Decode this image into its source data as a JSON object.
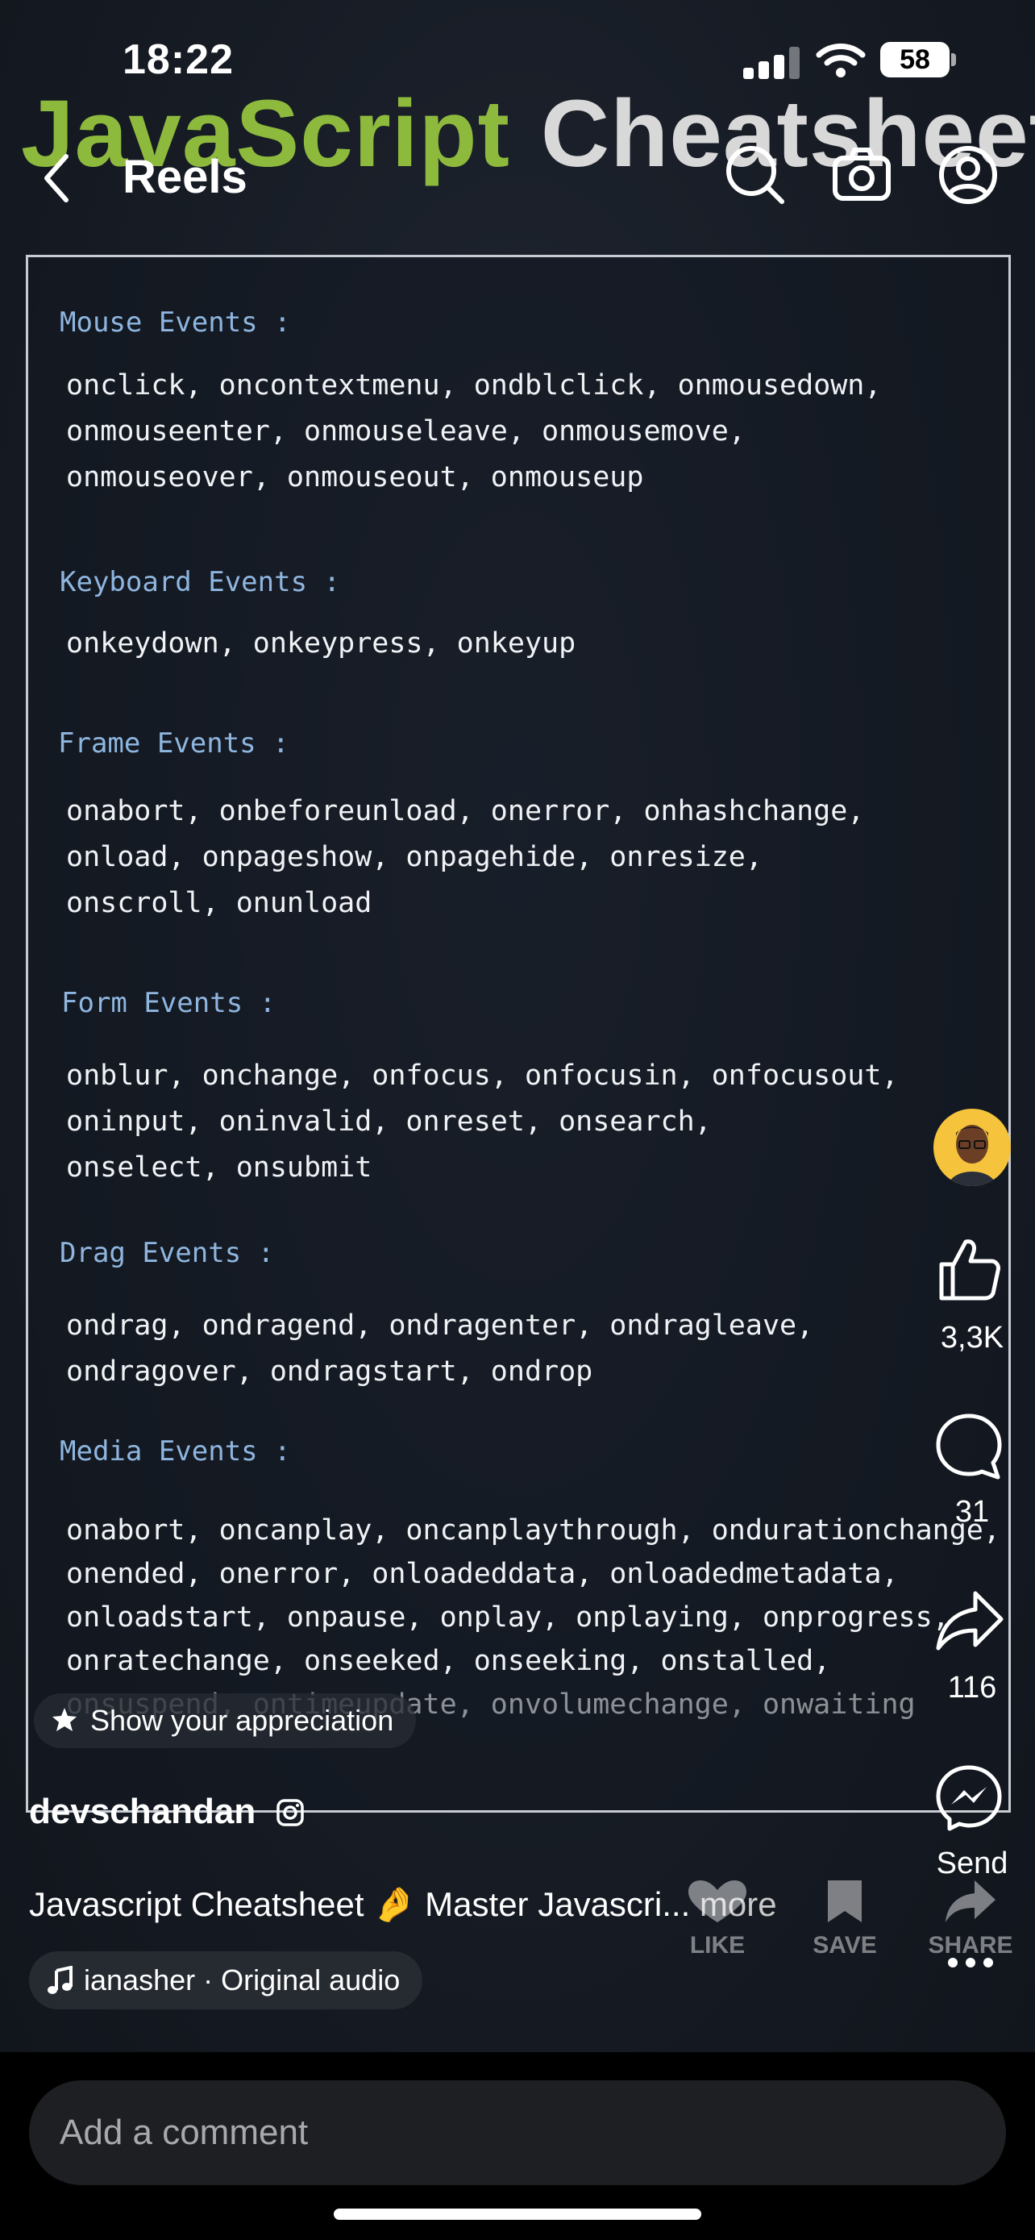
{
  "status": {
    "time": "18:22",
    "battery": "58"
  },
  "video": {
    "title_part1": "JavaScript",
    "title_part2": "Cheatsheet"
  },
  "nav": {
    "title": "Reels"
  },
  "sections": [
    {
      "title": "Mouse Events :",
      "lines": [
        "onclick, oncontextmenu, ondblclick, onmousedown,",
        "onmouseenter, onmouseleave, onmousemove,",
        "onmouseover, onmouseout, onmouseup"
      ]
    },
    {
      "title": "Keyboard Events :",
      "lines": [
        "onkeydown, onkeypress, onkeyup"
      ]
    },
    {
      "title": "Frame Events :",
      "lines": [
        "onabort, onbeforeunload, onerror, onhashchange,",
        "onload, onpageshow, onpagehide, onresize,",
        "onscroll, onunload"
      ]
    },
    {
      "title": "Form Events :",
      "lines": [
        "onblur, onchange, onfocus, onfocusin, onfocusout,",
        "oninput, oninvalid, onreset, onsearch,",
        "onselect, onsubmit"
      ]
    },
    {
      "title": "Drag Events :",
      "lines": [
        "ondrag, ondragend, ondragenter, ondragleave,",
        "ondragover, ondragstart, ondrop"
      ]
    },
    {
      "title": "Media Events :",
      "lines": [
        "onabort, oncanplay, oncanplaythrough, ondurationchange,",
        "onended, onerror, onloadeddata, onloadedmetadata,",
        "onloadstart, onpause, onplay, onplaying, onprogress,",
        "onratechange, onseeked, onseeking, onstalled,",
        "onsuspend, ontimeupdate, onvolumechange, onwaiting"
      ]
    }
  ],
  "appreciation": "Show your appreciation",
  "actions": {
    "likes": "3,3K",
    "comments": "31",
    "shares": "116",
    "send": "Send"
  },
  "author": {
    "username": "devschandan"
  },
  "caption": {
    "text": "Javascript Cheatsheet 🤌 Master Javascri...",
    "more": " more"
  },
  "audio": "ianasher · Original audio",
  "overlay_buttons": {
    "like": "LIKE",
    "save": "SAVE",
    "share": "SHARE"
  },
  "comment": {
    "placeholder": "Add a comment"
  },
  "colors": {
    "title_green": "#8dba3d",
    "section_blue": "#8fb6e0",
    "avatar_yellow": "#f5c43c"
  }
}
